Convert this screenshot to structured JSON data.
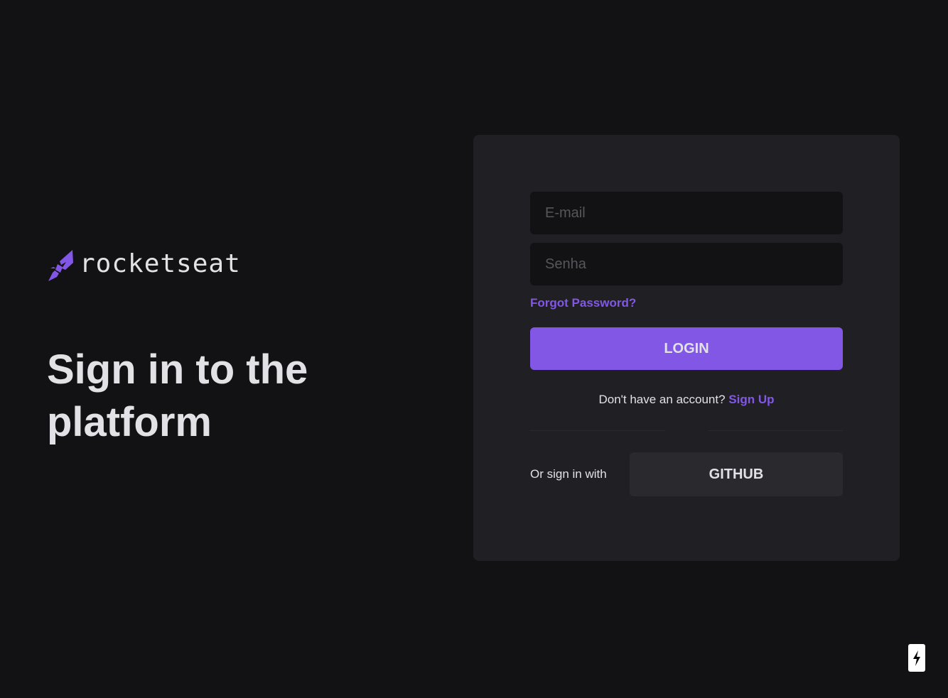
{
  "brand": {
    "name": "rocketseat",
    "accent_color": "#8257e5",
    "background_color": "#121214",
    "card_color": "#202024"
  },
  "hero": {
    "title": "Sign in to the platform"
  },
  "form": {
    "email": {
      "placeholder": "E-mail",
      "value": ""
    },
    "password": {
      "placeholder": "Senha",
      "value": ""
    },
    "forgot_label": "Forgot Password?",
    "login_label": "LOGIN",
    "signup_prompt": "Don't have an account?",
    "signup_label": "Sign Up"
  },
  "social": {
    "label": "Or sign in with",
    "github_label": "GITHUB"
  },
  "corner_badge": {
    "icon": "lightning-bolt-icon"
  }
}
